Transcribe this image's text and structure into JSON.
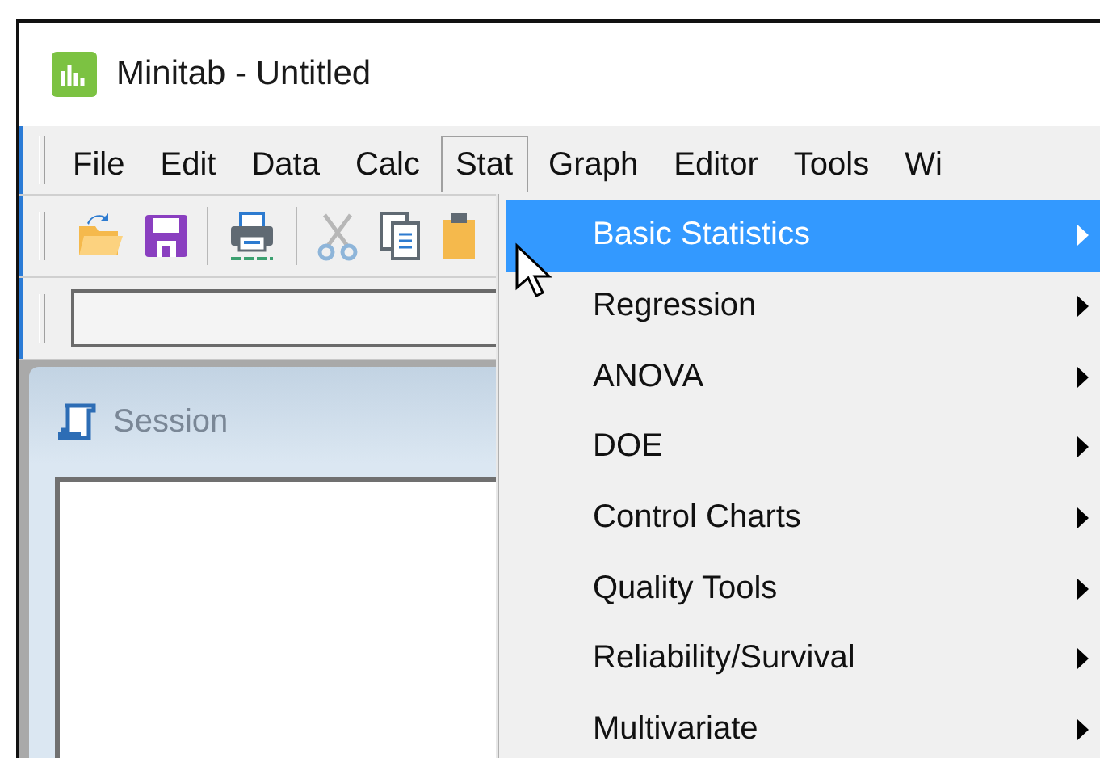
{
  "window": {
    "title": "Minitab - Untitled"
  },
  "menu_bar": [
    {
      "label": "File",
      "selected": false
    },
    {
      "label": "Edit",
      "selected": false
    },
    {
      "label": "Data",
      "selected": false
    },
    {
      "label": "Calc",
      "selected": false
    },
    {
      "label": "Stat",
      "selected": true
    },
    {
      "label": "Graph",
      "selected": false
    },
    {
      "label": "Editor",
      "selected": false
    },
    {
      "label": "Tools",
      "selected": false
    },
    {
      "label": "Wi",
      "selected": false
    }
  ],
  "toolbar": [
    {
      "kind": "open",
      "disabled": false
    },
    {
      "kind": "save",
      "disabled": false
    },
    {
      "kind": "separator"
    },
    {
      "kind": "print",
      "disabled": false
    },
    {
      "kind": "separator"
    },
    {
      "kind": "cut",
      "disabled": true
    },
    {
      "kind": "copy",
      "disabled": false
    },
    {
      "kind": "paste",
      "disabled": false
    }
  ],
  "session": {
    "title": "Session"
  },
  "stat_menu": [
    {
      "label": "Basic Statistics",
      "selected": true,
      "has_submenu": true
    },
    {
      "label": "Regression",
      "selected": false,
      "has_submenu": true
    },
    {
      "label": "ANOVA",
      "selected": false,
      "has_submenu": true
    },
    {
      "label": "DOE",
      "selected": false,
      "has_submenu": true
    },
    {
      "label": "Control Charts",
      "selected": false,
      "has_submenu": true
    },
    {
      "label": "Quality Tools",
      "selected": false,
      "has_submenu": true
    },
    {
      "label": "Reliability/Survival",
      "selected": false,
      "has_submenu": true
    },
    {
      "label": "Multivariate",
      "selected": false,
      "has_submenu": true
    }
  ]
}
